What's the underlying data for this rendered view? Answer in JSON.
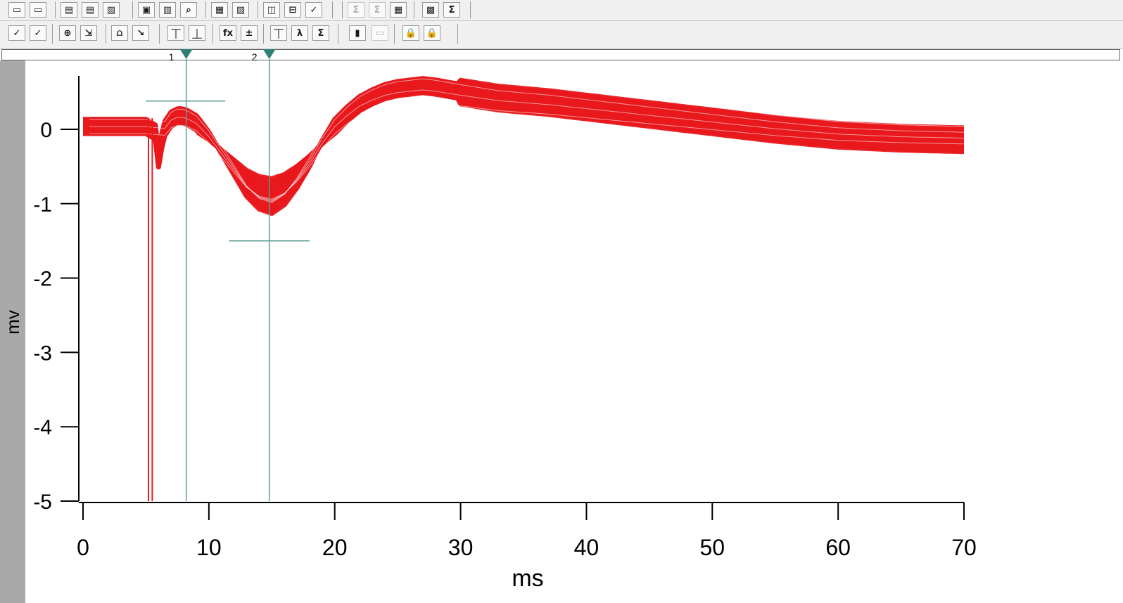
{
  "toolbars": {
    "top": [
      {
        "name": "open-experiment-button",
        "icon": "folder-open-icon",
        "glyph": "▭"
      },
      {
        "name": "save-experiment-button",
        "icon": "folder-save-icon",
        "glyph": "▭"
      },
      {
        "name": "open-procedure-button",
        "icon": "folder-arrow-icon",
        "glyph": "▤"
      },
      {
        "name": "save-procedure-button",
        "icon": "folder-disk-icon",
        "glyph": "▤"
      },
      {
        "name": "load-waves-button",
        "icon": "waves-folder-icon",
        "glyph": "▧"
      },
      {
        "name": "save-button",
        "icon": "floppy-disk-icon",
        "glyph": "▣"
      },
      {
        "name": "print-button",
        "icon": "printer-icon",
        "glyph": "▥"
      },
      {
        "name": "print-preview-button",
        "icon": "magnifier-page-icon",
        "glyph": "⌕"
      },
      {
        "name": "copy-graph-button",
        "icon": "clipboard-icon",
        "glyph": "▦"
      },
      {
        "name": "inspect-button",
        "icon": "page-search-icon",
        "glyph": "▨"
      },
      {
        "name": "layout-horizontal-button",
        "icon": "split-horizontal-icon",
        "glyph": "◫"
      },
      {
        "name": "layout-vertical-button",
        "icon": "split-vertical-icon",
        "glyph": "⊟"
      },
      {
        "name": "accept-add-button",
        "icon": "check-plus-icon",
        "glyph": "✓"
      },
      {
        "name": "sum-disabled-button",
        "icon": "sigma-disabled-icon",
        "glyph": "Σ",
        "disabled": true
      },
      {
        "name": "sum-list-disabled-button",
        "icon": "sigma-list-disabled-icon",
        "glyph": "Σ",
        "disabled": true
      },
      {
        "name": "table-button",
        "icon": "table-grid-icon",
        "glyph": "▦"
      },
      {
        "name": "chart-add-button",
        "icon": "chart-plus-icon",
        "glyph": "▩"
      },
      {
        "name": "stats-table-button",
        "icon": "sigma-table-icon",
        "glyph": "Σ"
      }
    ],
    "bottom": [
      {
        "name": "accept-button",
        "icon": "check-icon",
        "glyph": "✓"
      },
      {
        "name": "accept-all-button",
        "icon": "check-plus-icon",
        "glyph": "✓"
      },
      {
        "name": "zoom-button",
        "icon": "zoom-in-icon",
        "glyph": "⊕"
      },
      {
        "name": "autoscale-button",
        "icon": "autoscale-icon",
        "glyph": "⇲"
      },
      {
        "name": "baseline-button",
        "icon": "baseline-icon",
        "glyph": "⩍"
      },
      {
        "name": "trace-mode-button",
        "icon": "trace-arrow-icon",
        "glyph": "↘"
      },
      {
        "name": "graph-linear-button",
        "icon": "graph-line-icon",
        "glyph": "⏉"
      },
      {
        "name": "graph-decay-button",
        "icon": "graph-decay-icon",
        "glyph": "⏊"
      },
      {
        "name": "function-button",
        "icon": "fx-icon",
        "glyph": "fx"
      },
      {
        "name": "arithmetic-button",
        "icon": "plus-minus-times-icon",
        "glyph": "±"
      },
      {
        "name": "peak-button",
        "icon": "peak-graph-icon",
        "glyph": "⏉"
      },
      {
        "name": "lambda-sum-button",
        "icon": "lambda-sigma-icon",
        "glyph": "λ"
      },
      {
        "name": "results-table-button",
        "icon": "sigma-table-icon",
        "glyph": "Σ"
      },
      {
        "name": "statistics-button",
        "icon": "bar-stats-icon",
        "glyph": "▮"
      },
      {
        "name": "camera-disabled-button",
        "icon": "camera-disabled-icon",
        "glyph": "▭",
        "disabled": true
      },
      {
        "name": "lock-button",
        "icon": "padlock-icon",
        "glyph": "🔒"
      },
      {
        "name": "lock-all-button",
        "icon": "padlock-alt-icon",
        "glyph": "🔒"
      }
    ]
  },
  "cursors": [
    {
      "label": "1",
      "x": 8.2
    },
    {
      "label": "2",
      "x": 14.8
    }
  ],
  "chart_data": {
    "type": "line",
    "xlabel": "ms",
    "ylabel": "mv",
    "xlim": [
      0,
      70
    ],
    "ylim": [
      -5,
      0.7
    ],
    "xticks": [
      0,
      10,
      20,
      30,
      40,
      50,
      60,
      70
    ],
    "yticks": [
      0,
      -1,
      -2,
      -3,
      -4,
      -5
    ],
    "grid": false,
    "trace_color": "#e8181c",
    "cursor_color": "#5a9c92",
    "sweep_count": 20,
    "mean_trace": {
      "x": [
        0,
        5.2,
        5.5,
        5.7,
        6.0,
        6.4,
        7.0,
        7.6,
        8.2,
        9.0,
        10.0,
        11.0,
        12.0,
        13.0,
        14.0,
        15.0,
        16.0,
        17.0,
        18.0,
        19.0,
        20.0,
        21.0,
        22.0,
        23.0,
        24.0,
        25.0,
        26.0,
        27.0,
        28.0,
        30.0,
        33.0,
        37.0,
        41.0,
        45.0,
        50.0,
        55.0,
        60.0,
        65.0,
        70.0
      ],
      "y": [
        0.05,
        0.05,
        -5.0,
        0.05,
        -0.4,
        0.0,
        0.15,
        0.2,
        0.18,
        0.1,
        -0.1,
        -0.35,
        -0.6,
        -0.85,
        -1.0,
        -1.05,
        -0.95,
        -0.75,
        -0.5,
        -0.2,
        0.05,
        0.22,
        0.36,
        0.45,
        0.52,
        0.56,
        0.58,
        0.6,
        0.58,
        0.52,
        0.44,
        0.38,
        0.3,
        0.22,
        0.12,
        0.02,
        -0.06,
        -0.1,
        -0.12
      ]
    },
    "stimulus_artifact": {
      "x": [
        5.2,
        5.5
      ],
      "ymin": -5
    },
    "measure_markers": [
      {
        "label": "peak-marker",
        "x": [
          5.0,
          11.3
        ],
        "y": 0.38
      },
      {
        "label": "trough-marker",
        "x": [
          11.6,
          18.0
        ],
        "y": -1.5
      }
    ]
  }
}
